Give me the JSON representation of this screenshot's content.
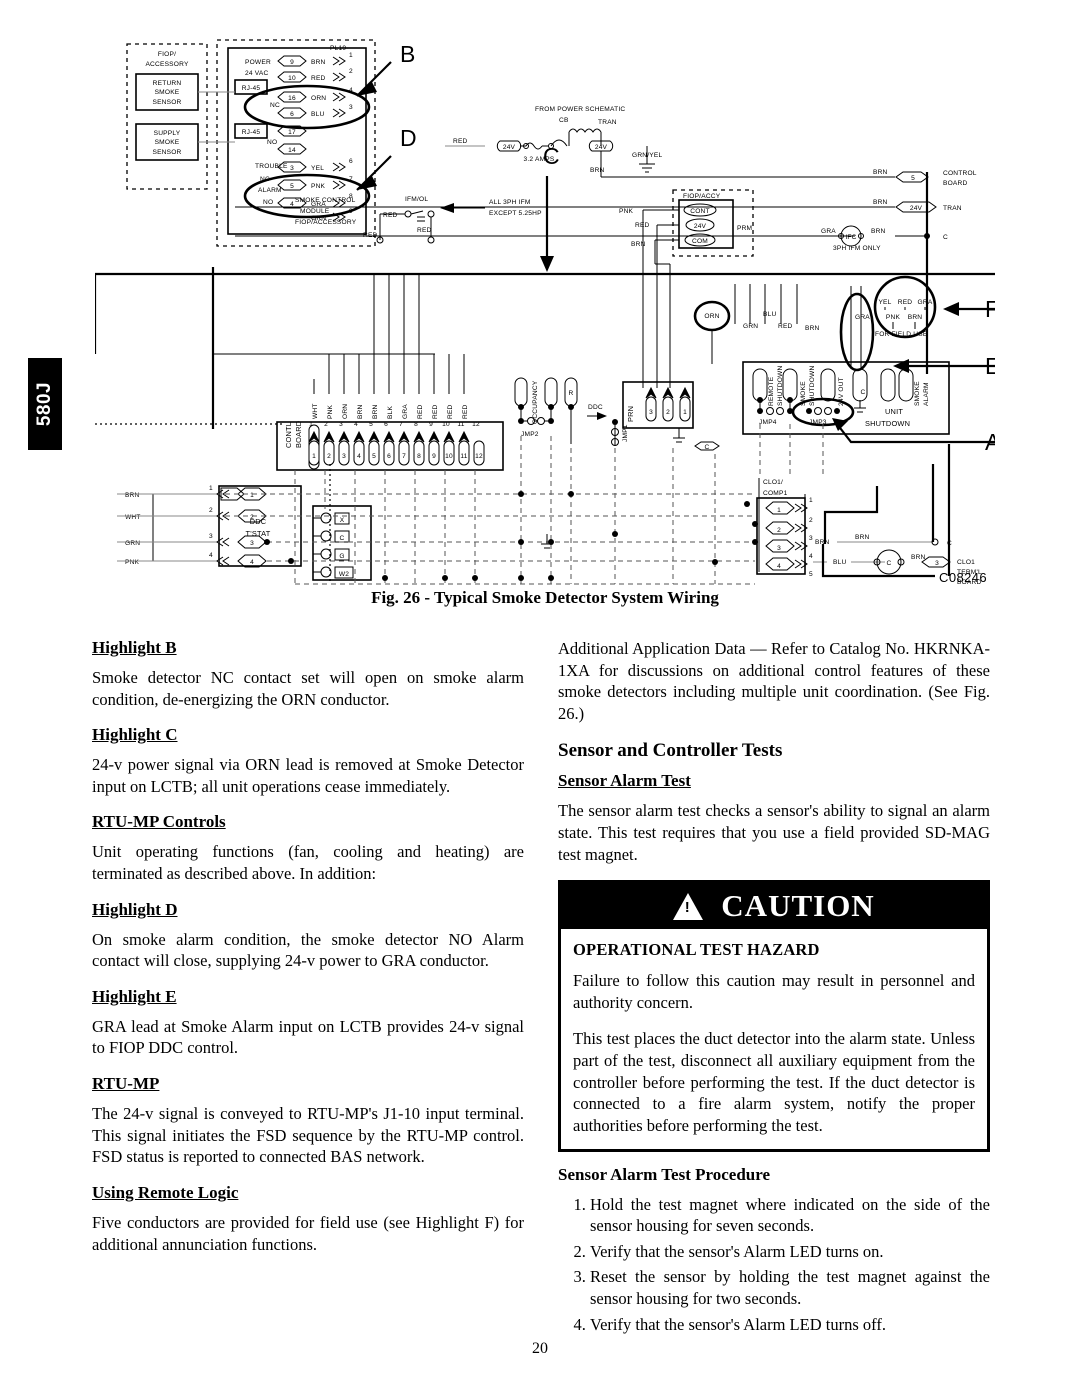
{
  "side_tab": {
    "label": "580J"
  },
  "figure": {
    "caption": "Fig. 26 - Typical Smoke Detector System Wiring",
    "code": "C08246",
    "highlight_labels": [
      "B",
      "D",
      "C",
      "F",
      "E",
      "A"
    ],
    "blocks": {
      "fiop_accessory": "FIOP/\nACCESSORY",
      "return_smoke_sensor": "RETURN\nSMOKE\nSENSOR",
      "supply_smoke_sensor": "SUPPLY\nSMOKE\nSENSOR",
      "power_24vac": "POWER\n24 VAC",
      "smoke_control_module": "SMOKE CONTROL\nMODULE\nFIOP/ACCESSORY",
      "rj45": "RJ-45",
      "pl19": "PL19-",
      "from_power_schematic": "FROM POWER SCHEMATIC",
      "tran": "TRAN",
      "cb": "CB",
      "amps": "3.2 AMPS",
      "grn_yel": "GRN/YEL",
      "control_board": "CONTROL\nBOARD",
      "ifc": "IFC",
      "ifc_note": "3PH IFM ONLY",
      "ifm_ol": "IFM/OL",
      "ifm_note": "ALL 3PH IFM\nEXCEPT 5.25HP",
      "fiop_accy": "FIOP/ACCY",
      "prm": "PRM",
      "contl_board": "CONTL\nBOARD",
      "occupancy": "OCCUPANCY",
      "ddc": "DDC",
      "prn": "PRN",
      "ddc_tstat": "DDC\nT'STAT",
      "clo1_comp1": "CLO1/\nCOMP1",
      "clo1_terml_board": "CLO1\nTERM'L\nBOARD",
      "unit_shutdown": "UNIT\nSHUTDOWN",
      "remote_shutdown": "REMOTE\nSHUTDOWN",
      "smoke_shutdown": "SMOKE\nSHUTDOWN",
      "smoke_alarm": "SMOKE\nALARM",
      "out_24v": "24V OUT",
      "for_field_use": "FOR FIELD USE",
      "nc": "NC",
      "no": "NO",
      "trouble": "TROUBLE",
      "alarm": "ALARM"
    },
    "wire_colors": [
      "BRN",
      "RED",
      "ORN",
      "BLU",
      "YEL",
      "PNK",
      "GRA",
      "GRN",
      "WHT",
      "BLK"
    ],
    "pl19_terminals": [
      "9",
      "10",
      "16",
      "6",
      "17",
      "14",
      "3",
      "5",
      "4"
    ],
    "pl19_pins": [
      "1",
      "2",
      "4",
      "3",
      "6",
      "7",
      "8",
      "9"
    ],
    "contl_board_wires": [
      "WHT",
      "PNK",
      "ORN",
      "BRN",
      "BRN",
      "BLK",
      "GRA",
      "RED",
      "RED",
      "RED",
      "RED"
    ],
    "contl_board_pins": [
      "1",
      "2",
      "3",
      "4",
      "5",
      "6",
      "7",
      "8",
      "9",
      "10",
      "11",
      "12"
    ],
    "jumpers": [
      "JMP2",
      "JMP1",
      "JMP4",
      "JMP3"
    ],
    "field_use_wires": [
      "YEL",
      "RED",
      "GRA",
      "PNK",
      "BRN"
    ],
    "ddc_tstat_wires": [
      "BRN",
      "WHT",
      "GRN",
      "PNK"
    ],
    "tstat_terminals": [
      "X",
      "C",
      "G",
      "W2"
    ],
    "volt_24": "24V",
    "c_label": "C"
  },
  "left_column": {
    "sections": [
      {
        "heading": "Highlight B",
        "style": "underline",
        "body": "Smoke detector NC contact set will open on smoke alarm condition, de-energizing the ORN conductor."
      },
      {
        "heading": "Highlight C",
        "style": "underline",
        "body": "24-v power signal via ORN lead is removed at Smoke Detector input on LCTB; all unit operations cease immediately."
      },
      {
        "heading": "RTU-MP Controls",
        "style": "underline",
        "body": "Unit operating functions (fan, cooling and heating) are terminated as described above. In addition:"
      },
      {
        "heading": "Highlight D",
        "style": "underline",
        "body": "On smoke alarm condition, the smoke detector NO Alarm contact will close, supplying 24-v power to GRA conductor."
      },
      {
        "heading": "Highlight E",
        "style": "underline",
        "body": "GRA lead at Smoke Alarm input on LCTB provides 24-v signal to FIOP DDC control."
      },
      {
        "heading": "RTU-MP",
        "style": "underline",
        "body": "The 24-v signal is conveyed to RTU-MP's J1-10 input terminal. This signal initiates the FSD sequence by the RTU-MP control. FSD status is reported to connected BAS network."
      },
      {
        "heading": "Using Remote Logic",
        "style": "underline",
        "body": "Five conductors are provided for field use (see Highlight F) for additional annunciation functions."
      }
    ]
  },
  "right_column": {
    "intro": "Additional Application Data — Refer to Catalog No. HKRNKA-1XA for discussions on additional control features of these smoke detectors including multiple unit coordination. (See Fig. 26.)",
    "major_heading": "Sensor and Controller Tests",
    "alarm_test_heading": "Sensor Alarm Test",
    "alarm_test_body": "The sensor alarm test checks a sensor's ability to signal an alarm state. This test requires that you use a field provided SD-MAG test magnet.",
    "caution": {
      "title": "CAUTION",
      "icon": "warning-triangle-icon",
      "hazard": "OPERATIONAL TEST HAZARD",
      "paragraphs": [
        "Failure to follow this caution may result in personnel and authority concern.",
        "This test places the duct detector into the alarm state. Unless part of the test, disconnect all auxiliary equipment from the controller before performing the test. If the duct detector is connected to a fire alarm system, notify the proper authorities before performing the test."
      ]
    },
    "procedure_heading": "Sensor Alarm Test Procedure",
    "procedure_steps": [
      "Hold the test magnet where indicated on the side of the sensor housing for seven seconds.",
      "Verify that the sensor's Alarm LED turns on.",
      "Verify that the sensor's Alarm LED turns off."
    ],
    "procedure_steps_full": [
      "Hold the test magnet where indicated on the side of the sensor housing for seven seconds.",
      "Verify that the sensor's Alarm LED turns on.",
      "Reset the sensor by holding the test magnet against the sensor housing for two seconds.",
      "Verify that the sensor's Alarm LED turns off."
    ]
  },
  "page_number": "20"
}
